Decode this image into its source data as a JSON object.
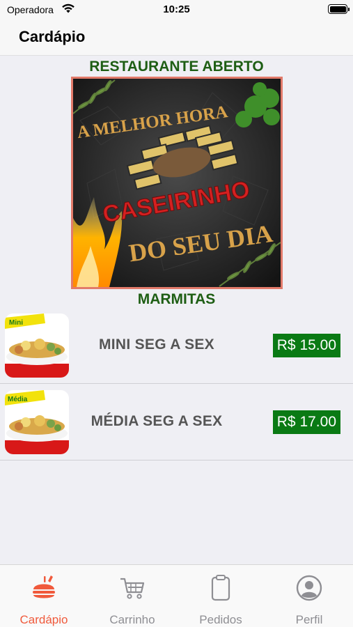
{
  "status_bar": {
    "carrier": "Operadora",
    "time": "10:25"
  },
  "nav": {
    "title": "Cardápio"
  },
  "restaurant_status": "RESTAURANTE ABERTO",
  "banner": {
    "top_text": "A MELHOR HORA",
    "brand": "CASEIRINHO",
    "bottom_text": "DO SEU DIA"
  },
  "category": "MARMITAS",
  "items": [
    {
      "name": "MINI SEG A SEX",
      "price": "R$ 15.00",
      "thumb_tag": "Mini"
    },
    {
      "name": "MÉDIA SEG A SEX",
      "price": "R$ 17.00",
      "thumb_tag": "Média"
    }
  ],
  "tabs": [
    {
      "label": "Cardápio",
      "icon": "menu-food-icon",
      "active": true
    },
    {
      "label": "Carrinho",
      "icon": "cart-icon",
      "active": false
    },
    {
      "label": "Pedidos",
      "icon": "clipboard-icon",
      "active": false
    },
    {
      "label": "Perfil",
      "icon": "profile-icon",
      "active": false
    }
  ],
  "colors": {
    "accent": "#f05a3c",
    "header_green": "#1e5e14",
    "price_green": "#0a7a14",
    "tab_inactive": "#8e8e93"
  }
}
